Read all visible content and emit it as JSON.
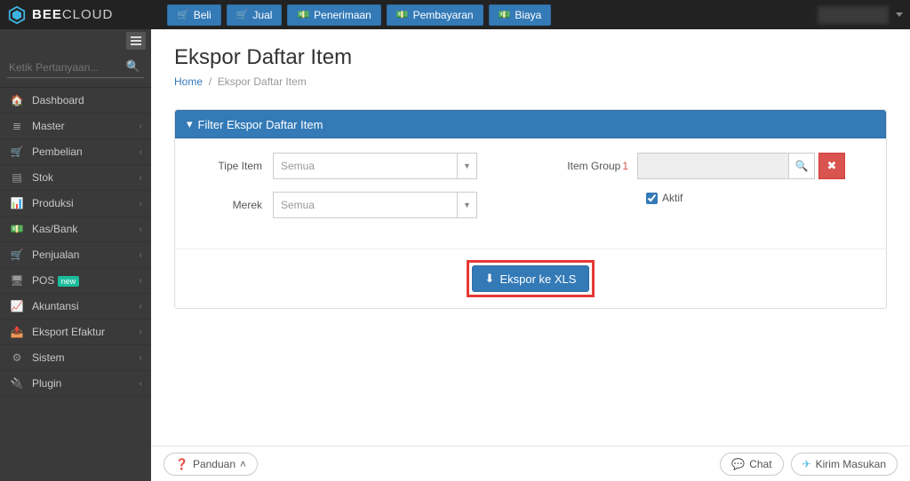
{
  "brand": {
    "name_strong": "BEE",
    "name_light": "CLOUD"
  },
  "quick_actions": [
    {
      "label": "Beli",
      "icon": "cart"
    },
    {
      "label": "Jual",
      "icon": "cart"
    },
    {
      "label": "Penerimaan",
      "icon": "money"
    },
    {
      "label": "Pembayaran",
      "icon": "money"
    },
    {
      "label": "Biaya",
      "icon": "money"
    }
  ],
  "sidebar": {
    "search_placeholder": "Ketik Pertanyaan...",
    "items": [
      {
        "icon": "🏠",
        "label": "Dashboard",
        "expandable": false
      },
      {
        "icon": "≣",
        "label": "Master",
        "expandable": true
      },
      {
        "icon": "🛒",
        "label": "Pembelian",
        "expandable": true
      },
      {
        "icon": "▤",
        "label": "Stok",
        "expandable": true
      },
      {
        "icon": "📊",
        "label": "Produksi",
        "expandable": true
      },
      {
        "icon": "💵",
        "label": "Kas/Bank",
        "expandable": true
      },
      {
        "icon": "🛒",
        "label": "Penjualan",
        "expandable": true
      },
      {
        "icon": "🖥",
        "label": "POS",
        "expandable": true,
        "badge": "new"
      },
      {
        "icon": "📈",
        "label": "Akuntansi",
        "expandable": true
      },
      {
        "icon": "📤",
        "label": "Eksport Efaktur",
        "expandable": true
      },
      {
        "icon": "⚙",
        "label": "Sistem",
        "expandable": true
      },
      {
        "icon": "🔌",
        "label": "Plugin",
        "expandable": true
      }
    ]
  },
  "page": {
    "title": "Ekspor Daftar Item",
    "breadcrumb_home": "Home",
    "breadcrumb_sep": "/",
    "breadcrumb_current": "Ekspor Daftar Item"
  },
  "panel": {
    "heading": "Filter Ekspor Daftar Item",
    "tipe_item_label": "Tipe Item",
    "tipe_item_value": "Semua",
    "merek_label": "Merek",
    "merek_value": "Semua",
    "item_group_label": "Item Group",
    "item_group_num": "1",
    "aktif_label": "Aktif",
    "aktif_checked": true,
    "export_button": "Ekspor ke XLS"
  },
  "footer": {
    "panduan": "Panduan",
    "chat": "Chat",
    "kirim": "Kirim Masukan"
  }
}
